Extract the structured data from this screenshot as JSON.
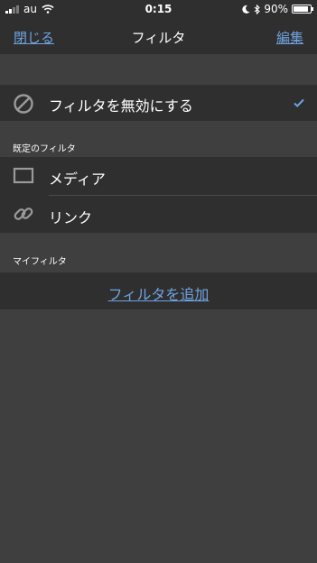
{
  "status_bar": {
    "carrier": "au",
    "time": "0:15",
    "battery_percent": "90%",
    "battery_level": 0.9,
    "icons": [
      "signal-icon",
      "wifi-icon",
      "moon-icon",
      "bluetooth-icon",
      "battery-icon"
    ]
  },
  "nav": {
    "close_label": "閉じる",
    "title": "フィルタ",
    "edit_label": "編集"
  },
  "disable_filter": {
    "label": "フィルタを無効にする",
    "icon": "prohibited-icon",
    "checked": true
  },
  "default_filters": {
    "header": "既定のフィルタ",
    "items": [
      {
        "label": "メディア",
        "icon": "media-icon"
      },
      {
        "label": "リンク",
        "icon": "link-icon"
      }
    ]
  },
  "my_filters": {
    "header": "マイフィルタ",
    "add_label": "フィルタを追加"
  },
  "colors": {
    "background": "#3f3f3f",
    "cell": "#2f2f2f",
    "accent": "#6fa3e0"
  }
}
